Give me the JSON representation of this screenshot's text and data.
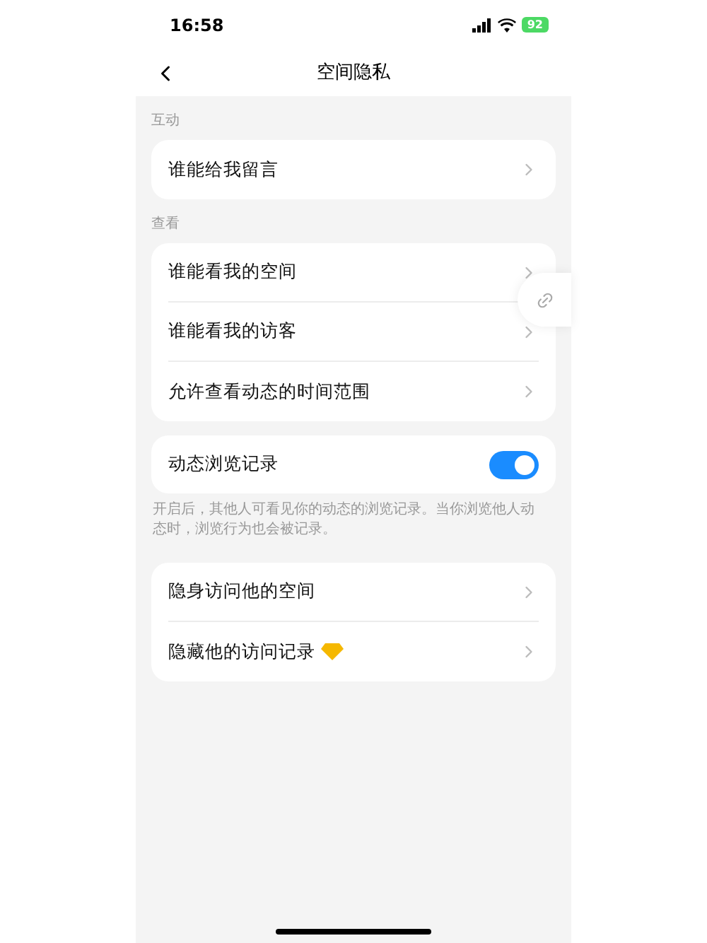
{
  "status_bar": {
    "time": "16:58",
    "battery": "92"
  },
  "nav": {
    "title": "空间隐私"
  },
  "sections": [
    {
      "kind": "group",
      "label": "互动",
      "items": [
        {
          "label": "谁能给我留言",
          "premium": false
        }
      ]
    },
    {
      "kind": "group",
      "label": "查看",
      "items": [
        {
          "label": "谁能看我的空间",
          "premium": false
        },
        {
          "label": "谁能看我的访客",
          "premium": false
        },
        {
          "label": "允许查看动态的时间范围",
          "premium": false
        }
      ]
    },
    {
      "kind": "toggle",
      "label": "动态浏览记录",
      "on": true,
      "note": "开启后，其他人可看见你的动态的浏览记录。当你浏览他人动态时，浏览行为也会被记录。"
    },
    {
      "kind": "group",
      "items": [
        {
          "label": "隐身访问他的空间",
          "premium": false
        },
        {
          "label": "隐藏他的访问记录",
          "premium": true
        }
      ]
    }
  ]
}
